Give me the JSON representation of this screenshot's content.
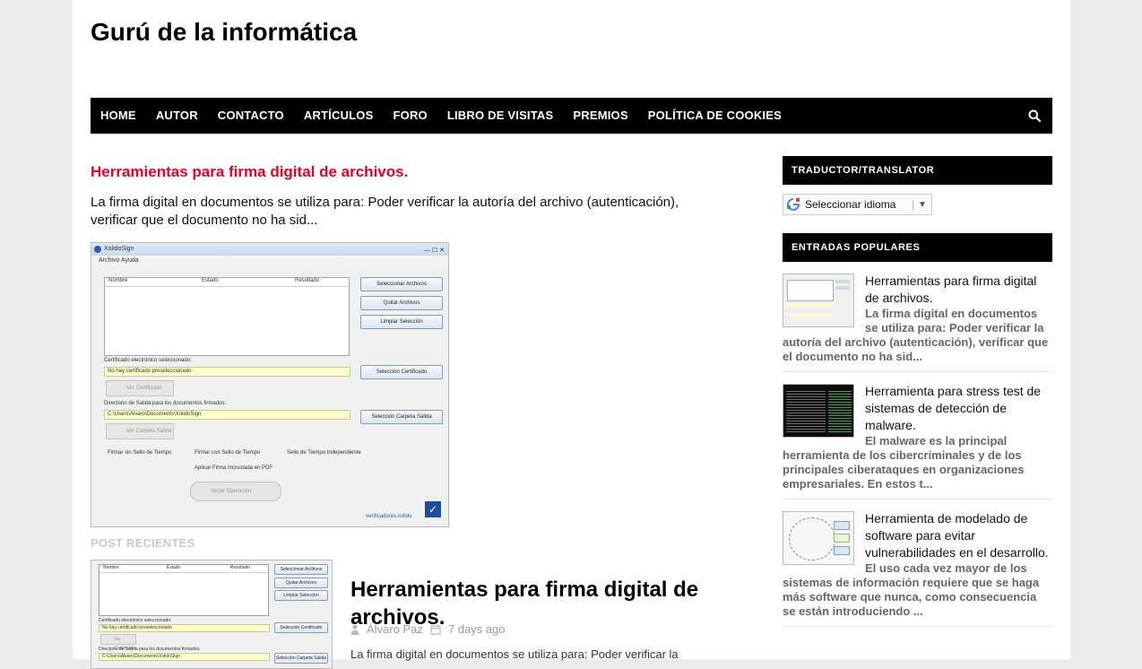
{
  "site": {
    "title": "Gurú de la informática"
  },
  "nav": {
    "items": [
      "HOME",
      "AUTOR",
      "CONTACTO",
      "ARTÍCULOS",
      "FORO",
      "LIBRO DE VISITAS",
      "PREMIOS",
      "POLÍTICA DE COOKIES"
    ]
  },
  "featured": {
    "title": "Herramientas para firma digital de archivos.",
    "excerpt": "La firma digital en documentos se utiliza para: Poder verificar la autoría del archivo (autenticación), verificar que el documento no ha sid..."
  },
  "screenshot_app": {
    "window_title": "XolidoSign",
    "menu": "Archivo   Ayuda",
    "columns": [
      "Nombre",
      "Estado",
      "Resultado"
    ],
    "buttons": {
      "select_files": "Seleccionar Archivos",
      "remove_files": "Quitar Archivos",
      "clear_selection": "Limpiar Selección",
      "select_cert": "Selección Certificado",
      "select_folder": "Selección Carpeta Salida",
      "view_cert": "Ver Certificado",
      "view_folder": "Ver Carpeta Salida",
      "start": "Iniciar Operación"
    },
    "labels": {
      "cert_label": "Certificado electrónico seleccionado:",
      "cert_value": "No hay certificado preseleccionado",
      "folder_label": "Directorio de Salida para los documentos firmados:",
      "folder_value": "C:\\Users\\Alvaro\\Documents\\XolidoSign",
      "radio1": "Firmar sin Sello de Tiempo",
      "radio2": "Firmar con Sello de Tiempo",
      "radio3": "Sello de Tiempo Independiente",
      "checkbox": "Aplicar Firma Incrustada en PDF",
      "footer": "verificadores.xolido"
    }
  },
  "recent": {
    "section_label": "POST RECIENTES",
    "title": "Herramientas para firma digital de archivos.",
    "author": "Álvaro Paz",
    "date": "7 days ago",
    "excerpt": "La firma digital en documentos se utiliza para: Poder verificar la"
  },
  "sidebar": {
    "translator_heading": "TRADUCTOR/TRANSLATOR",
    "language_select": "Seleccionar idioma",
    "popular_heading": "ENTRADAS POPULARES",
    "popular": [
      {
        "title": "Herramientas para firma digital de archivos.",
        "snippet": "La firma digital en documentos se utiliza para: Poder verificar la autoría del archivo (autenticación), verificar que el documento no ha sid..."
      },
      {
        "title": "Herramienta para stress test de sistemas de detección de malware.",
        "snippet": "El malware es la principal herramienta de los cibercriminales y de los principales ciberataques en organizaciones empresariales. En estos t..."
      },
      {
        "title": "Herramienta de modelado de software para evitar vulnerabilidades en el desarrollo.",
        "snippet": "El uso cada vez mayor de los sistemas de información requiere que se haga más software que nunca, como consecuencia se están introduciendo ..."
      }
    ]
  },
  "colors": {
    "accent_red": "#e4002b",
    "nav_bg": "#000000",
    "page_bg": "#ebebeb"
  }
}
